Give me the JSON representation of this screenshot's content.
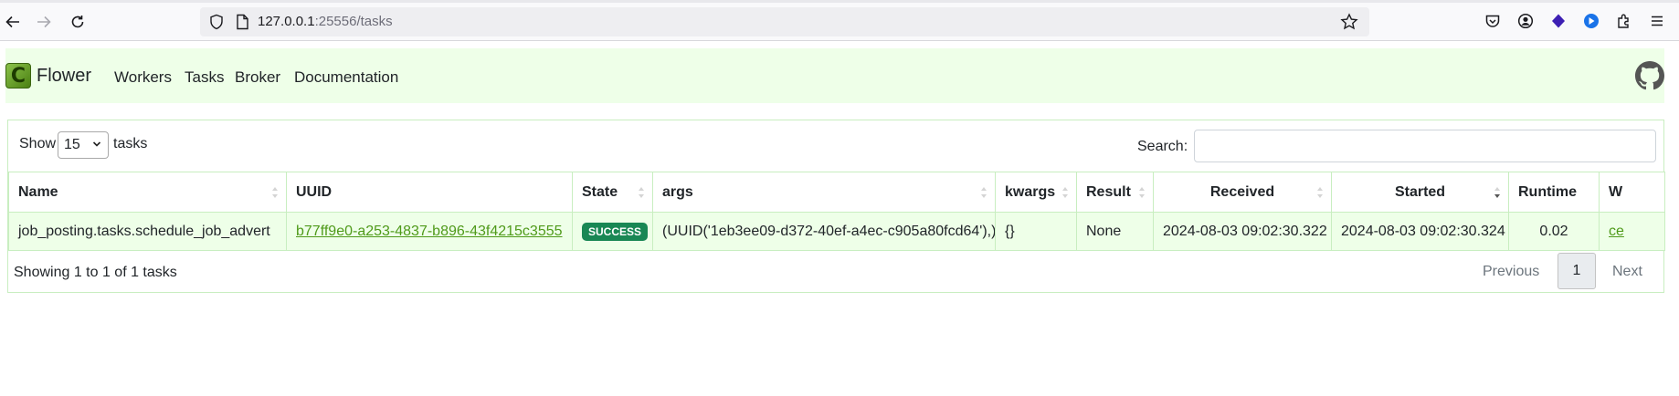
{
  "browser": {
    "url_host": "127.0.0.1",
    "url_rest": ":25556/tasks"
  },
  "navbar": {
    "brand_letter": "C",
    "brand": "Flower",
    "links": [
      "Workers",
      "Tasks",
      "Broker",
      "Documentation"
    ]
  },
  "controls": {
    "show_label": "Show",
    "show_value": "15",
    "tasks_label": "tasks",
    "search_label": "Search:",
    "search_value": ""
  },
  "table": {
    "columns": [
      "Name",
      "UUID",
      "State",
      "args",
      "kwargs",
      "Result",
      "Received",
      "Started",
      "Runtime",
      "W"
    ],
    "rows": [
      {
        "name": "job_posting.tasks.schedule_job_advert",
        "uuid": "b77ff9e0-a253-4837-b896-43f4215c3555",
        "state": "SUCCESS",
        "args": "(UUID('1eb3ee09-d372-40ef-a4ec-c905a80fcd64'),)",
        "kwargs": "{}",
        "result": "None",
        "received": "2024-08-03 09:02:30.322",
        "started": "2024-08-03 09:02:30.324",
        "runtime": "0.02",
        "worker": "ce"
      }
    ]
  },
  "footer": {
    "info": "Showing 1 to 1 of 1 tasks",
    "previous": "Previous",
    "page": "1",
    "next": "Next"
  },
  "colors": {
    "navbar_bg": "#eeffe8",
    "row_bg": "#eeffe8",
    "badge_success": "#198754",
    "link": "#4f9a1a"
  }
}
